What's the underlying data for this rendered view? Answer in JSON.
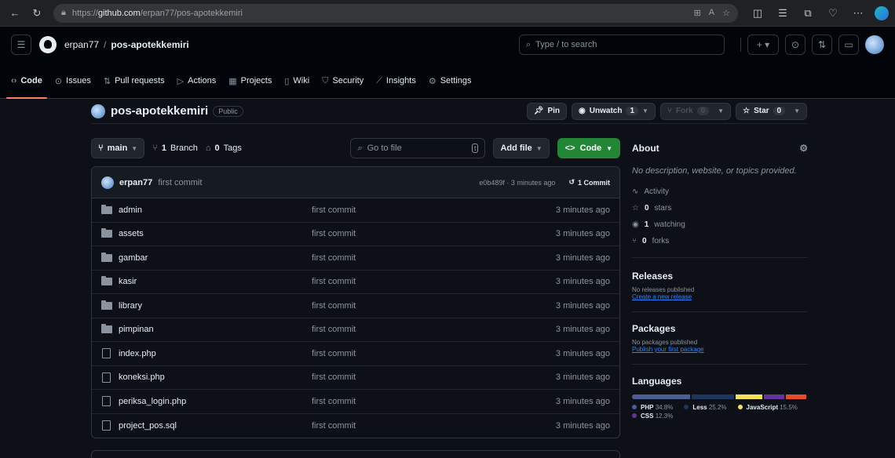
{
  "browser": {
    "url_prefix": "https://",
    "url_host": "github.com",
    "url_path": "/erpan77/pos-apotekkemiri"
  },
  "header": {
    "owner": "erpan77",
    "repo": "pos-apotekkemiri",
    "search_placeholder": "Type / to search",
    "search_key": "/"
  },
  "tabs": [
    {
      "label": "Code",
      "icon": "code-icon"
    },
    {
      "label": "Issues",
      "icon": "issue-icon"
    },
    {
      "label": "Pull requests",
      "icon": "pull-request-icon"
    },
    {
      "label": "Actions",
      "icon": "play-icon"
    },
    {
      "label": "Projects",
      "icon": "table-icon"
    },
    {
      "label": "Wiki",
      "icon": "book-icon"
    },
    {
      "label": "Security",
      "icon": "shield-icon"
    },
    {
      "label": "Insights",
      "icon": "graph-icon"
    },
    {
      "label": "Settings",
      "icon": "gear-icon"
    }
  ],
  "repo": {
    "name": "pos-apotekkemiri",
    "visibility": "Public",
    "pin": "Pin",
    "unwatch": "Unwatch",
    "watch_count": "1",
    "fork": "Fork",
    "fork_count": "0",
    "star": "Star",
    "star_count": "0"
  },
  "toolbar": {
    "branch": "main",
    "branch_count": "1",
    "branch_word": "Branch",
    "tag_count": "0",
    "tag_word": "Tags",
    "goto_placeholder": "Go to file",
    "goto_key": "t",
    "add_file": "Add file",
    "code": "Code"
  },
  "commit": {
    "user": "erpan77",
    "message": "first commit",
    "meta": "e0b489f · 3 minutes ago",
    "count": "1 Commit"
  },
  "files": [
    {
      "name": "admin",
      "type": "dir",
      "msg": "first commit",
      "time": "3 minutes ago"
    },
    {
      "name": "assets",
      "type": "dir",
      "msg": "first commit",
      "time": "3 minutes ago"
    },
    {
      "name": "gambar",
      "type": "dir",
      "msg": "first commit",
      "time": "3 minutes ago"
    },
    {
      "name": "kasir",
      "type": "dir",
      "msg": "first commit",
      "time": "3 minutes ago"
    },
    {
      "name": "library",
      "type": "dir",
      "msg": "first commit",
      "time": "3 minutes ago"
    },
    {
      "name": "pimpinan",
      "type": "dir",
      "msg": "first commit",
      "time": "3 minutes ago"
    },
    {
      "name": "index.php",
      "type": "file",
      "msg": "first commit",
      "time": "3 minutes ago"
    },
    {
      "name": "koneksi.php",
      "type": "file",
      "msg": "first commit",
      "time": "3 minutes ago"
    },
    {
      "name": "periksa_login.php",
      "type": "file",
      "msg": "first commit",
      "time": "3 minutes ago"
    },
    {
      "name": "project_pos.sql",
      "type": "file",
      "msg": "first commit",
      "time": "3 minutes ago"
    }
  ],
  "about": {
    "title": "About",
    "desc": "No description, website, or topics provided.",
    "activity": "Activity",
    "stars_num": "0",
    "stars_word": "stars",
    "watching_num": "1",
    "watching_word": "watching",
    "forks_num": "0",
    "forks_word": "forks"
  },
  "releases": {
    "title": "Releases",
    "none": "No releases published",
    "link": "Create a new release"
  },
  "packages": {
    "title": "Packages",
    "none": "No packages published",
    "link": "Publish your first package"
  },
  "languages": {
    "title": "Languages",
    "items": [
      {
        "name": "PHP",
        "pct": "34.8%",
        "value": 34.8,
        "color": "#4F5D95"
      },
      {
        "name": "Less",
        "pct": "25.2%",
        "value": 25.2,
        "color": "#1d365d"
      },
      {
        "name": "JavaScript",
        "pct": "15.5%",
        "value": 15.5,
        "color": "#f1e05a"
      },
      {
        "name": "CSS",
        "pct": "12.3%",
        "value": 12.3,
        "color": "#663399"
      },
      {
        "name": "",
        "pct": "",
        "value": 12.2,
        "color": "#e34c26"
      }
    ]
  }
}
